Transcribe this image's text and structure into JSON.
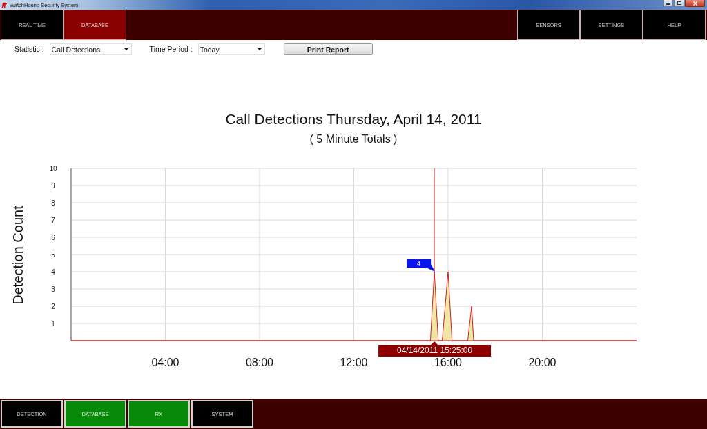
{
  "window": {
    "title": "WatchHound Security System"
  },
  "top_nav": {
    "left": [
      {
        "label": "REAL TIME",
        "selected": false
      },
      {
        "label": "DATABASE",
        "selected": true
      }
    ],
    "right": [
      {
        "label": "SENSORS",
        "selected": false
      },
      {
        "label": "SETTINGS",
        "selected": false
      },
      {
        "label": "HELP",
        "selected": false
      }
    ]
  },
  "filters": [
    {
      "kind": "dropdown",
      "label": "Statistic :",
      "value": "Call Detections"
    },
    {
      "kind": "dropdown",
      "label": "Time Period :",
      "value": "Today"
    }
  ],
  "print_button": {
    "label": "Print Report"
  },
  "chart": {
    "subtitle": "( 5 Minute Totals )",
    "chart_data": {
      "type": "area",
      "title": "Call Detections Thursday, April 14, 2011",
      "ylabel": "Detection Count",
      "x": [
        0,
        15.25,
        15.4167,
        15.5833,
        15.75,
        16,
        16.1667,
        16.8333,
        17,
        17.0833,
        24
      ],
      "series": [
        {
          "color": "#efe7a6",
          "values": [
            0,
            0,
            4,
            0,
            0,
            4,
            0,
            0,
            2,
            0,
            0
          ]
        }
      ],
      "xlim": [
        0,
        24
      ],
      "ylim": [
        0,
        10
      ],
      "xticks": [
        {
          "value": 4,
          "label": "04:00"
        },
        {
          "value": 8,
          "label": "08:00"
        },
        {
          "value": 12,
          "label": "12:00"
        },
        {
          "value": 16,
          "label": "16:00"
        },
        {
          "value": 20,
          "label": "20:00"
        }
      ],
      "yticks": [
        1,
        2,
        3,
        4,
        5,
        6,
        7,
        8,
        9,
        10
      ],
      "grid": true,
      "ref_lines": [
        {
          "axis": "x",
          "value": 15.4167,
          "label": "04/14/2011 15:25:00"
        }
      ],
      "annotations": [
        {
          "text": "4",
          "x": 15.4167,
          "y": 4
        }
      ]
    }
  },
  "bottom_nav": [
    {
      "label": "DETECTION",
      "on": false
    },
    {
      "label": "DATABASE",
      "on": true
    },
    {
      "label": "RX",
      "on": true
    },
    {
      "label": "SYSTEM",
      "on": false
    }
  ]
}
